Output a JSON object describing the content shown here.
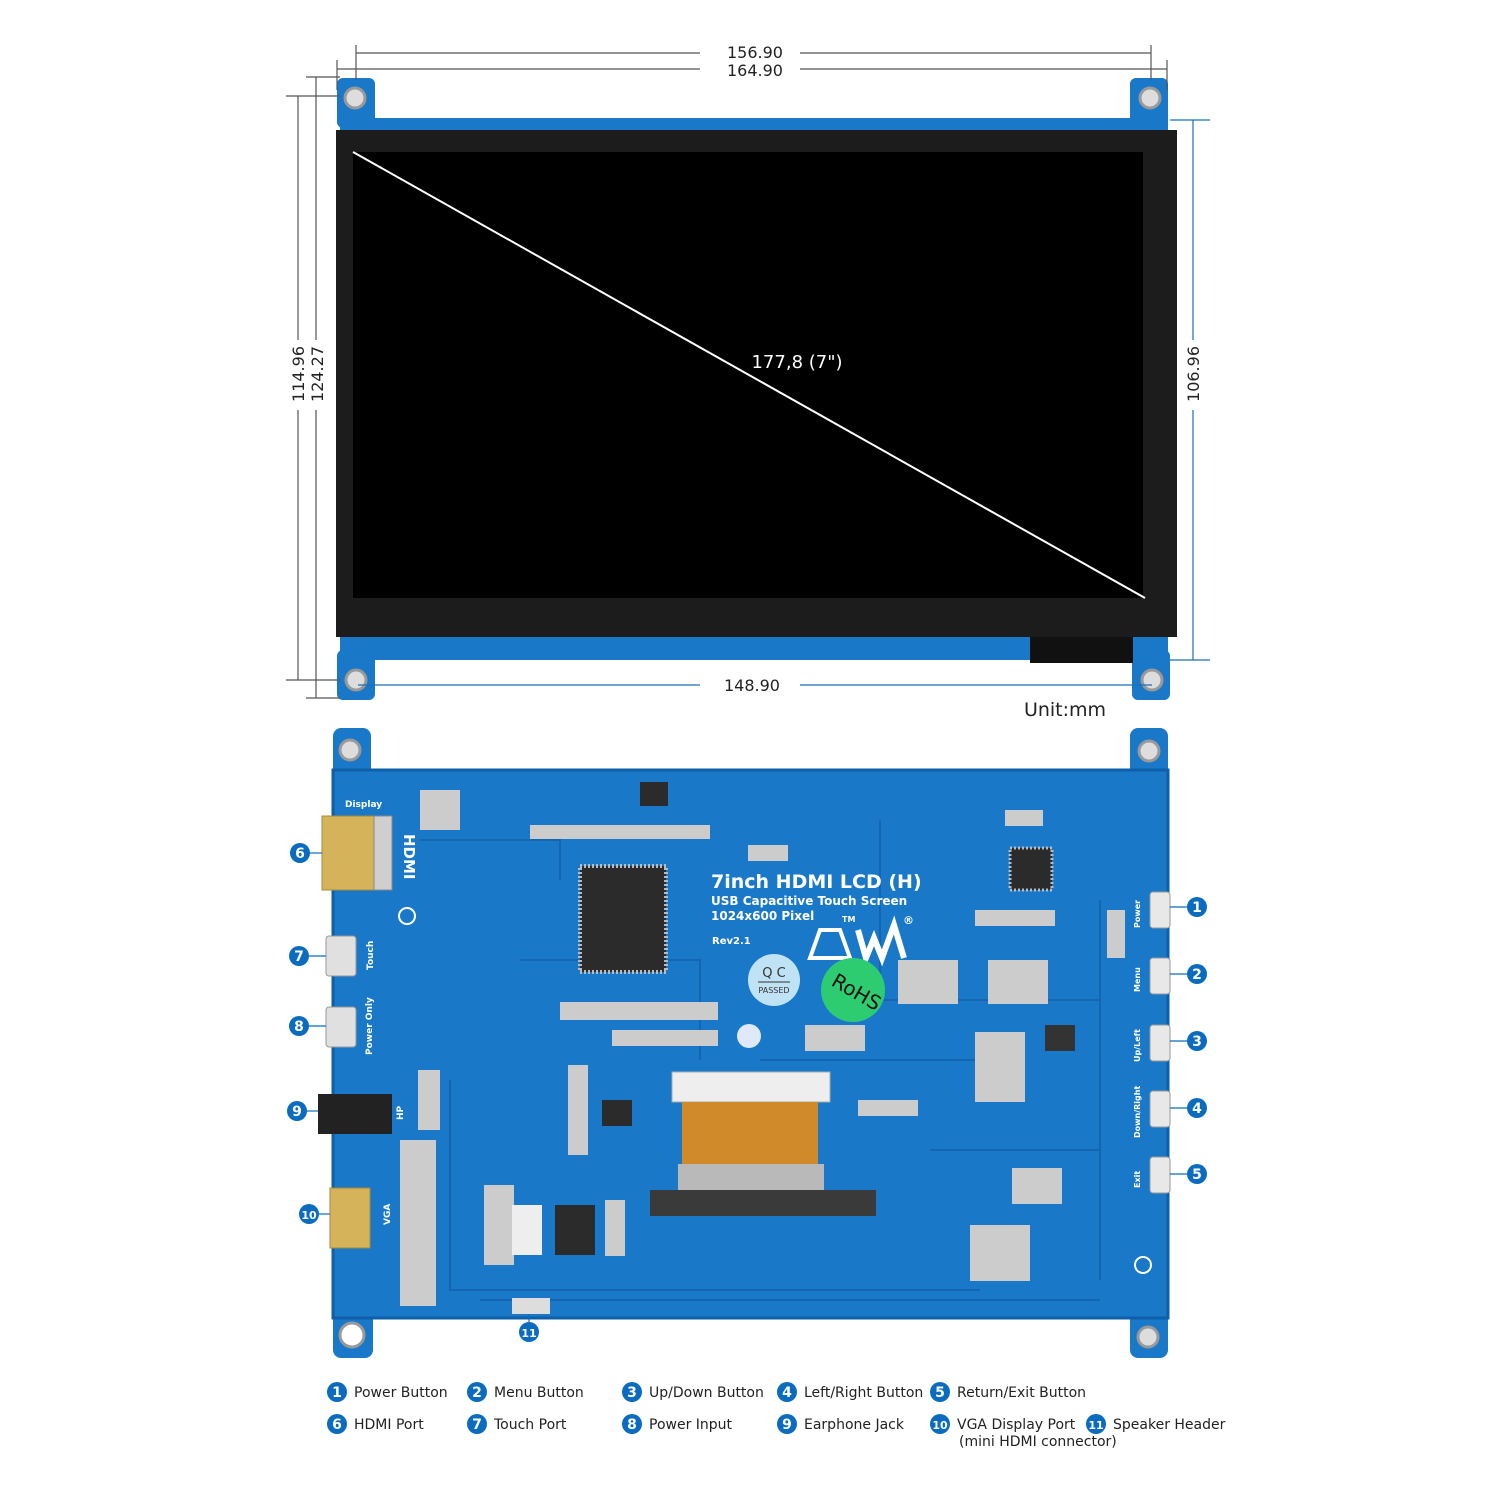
{
  "colors": {
    "pcb_blue": "#1a78c8",
    "pcb_edge": "#0e5fa8",
    "callout_blue": "#0b6cbf",
    "dimension_gray": "#555555",
    "dimension_blue": "#1a6fb8",
    "screen": "#000000",
    "bezel": "#1c1c1c",
    "rohs_green": "#2ecc71",
    "qc_label": "#bfe3f5"
  },
  "dimensions": {
    "inner_width": "156.90",
    "outer_width": "164.90",
    "inner_height": "114.96",
    "outer_height": "124.27",
    "panel_height": "106.96",
    "panel_width": "148.90",
    "diagonal": "177,8 (7\")",
    "unit": "Unit:mm"
  },
  "board": {
    "title": "7inch HDMI LCD (H)",
    "subtitle": "USB Capacitive Touch Screen",
    "resolution": "1024x600 Pixel",
    "revision": "Rev2.1",
    "qc_top": "Q C",
    "qc_bottom": "PASSED",
    "rohs": "RoHS",
    "logo_tm": "TM",
    "logo_r": "®",
    "silkscreen": {
      "display": "Display",
      "hdmi": "HDMI",
      "touch": "Touch",
      "power_only": "Power Only",
      "hp": "HP",
      "vga": "VGA",
      "power": "Power",
      "menu": "Menu",
      "up_left": "Up/Left",
      "down_right": "Down/Right",
      "exit": "Exit"
    }
  },
  "callouts": [
    "1",
    "2",
    "3",
    "4",
    "5",
    "6",
    "7",
    "8",
    "9",
    "10",
    "11"
  ],
  "legend": [
    {
      "num": "1",
      "label": "Power Button"
    },
    {
      "num": "2",
      "label": "Menu Button"
    },
    {
      "num": "3",
      "label": "Up/Down Button"
    },
    {
      "num": "4",
      "label": "Left/Right Button"
    },
    {
      "num": "5",
      "label": "Return/Exit Button"
    },
    {
      "num": "6",
      "label": "HDMI Port"
    },
    {
      "num": "7",
      "label": "Touch Port"
    },
    {
      "num": "8",
      "label": "Power Input"
    },
    {
      "num": "9",
      "label": "Earphone Jack"
    },
    {
      "num": "10",
      "label": "VGA Display Port",
      "label2": "(mini HDMI connector)"
    },
    {
      "num": "11",
      "label": "Speaker Header"
    }
  ]
}
